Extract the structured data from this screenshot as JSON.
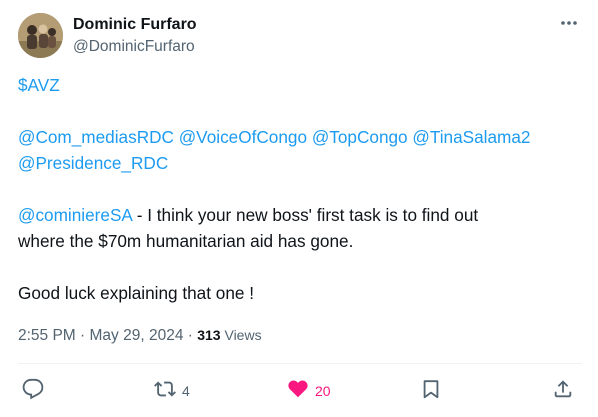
{
  "author": {
    "display_name": "Dominic Furfaro",
    "handle": "@DominicFurfaro"
  },
  "tweet": {
    "cashtag": "$AVZ",
    "mentions_line1": [
      "@Com_mediasRDC",
      "@VoiceOfCongo",
      "@TopCongo",
      "@TinaSalama2"
    ],
    "mentions_line2": [
      "@Presidence_RDC"
    ],
    "reply_mention": "@cominiereSA",
    "text_line1": " - I think your new boss' first task is to find out",
    "text_line2": "where the $70m humanitarian aid has gone.",
    "text_line3": "Good luck explaining that one !"
  },
  "meta": {
    "time": "2:55 PM",
    "separator": " · ",
    "date": "May 29, 2024",
    "views_count": "313",
    "views_label": " Views"
  },
  "actions": {
    "retweets": "4",
    "likes": "20"
  },
  "icons": {
    "more": "more-dots-icon",
    "reply": "reply-icon",
    "retweet": "retweet-icon",
    "like": "heart-icon",
    "bookmark": "bookmark-icon",
    "share": "share-icon"
  },
  "colors": {
    "link": "#1d9bf0",
    "secondary_text": "#536471",
    "like": "#f91880"
  }
}
